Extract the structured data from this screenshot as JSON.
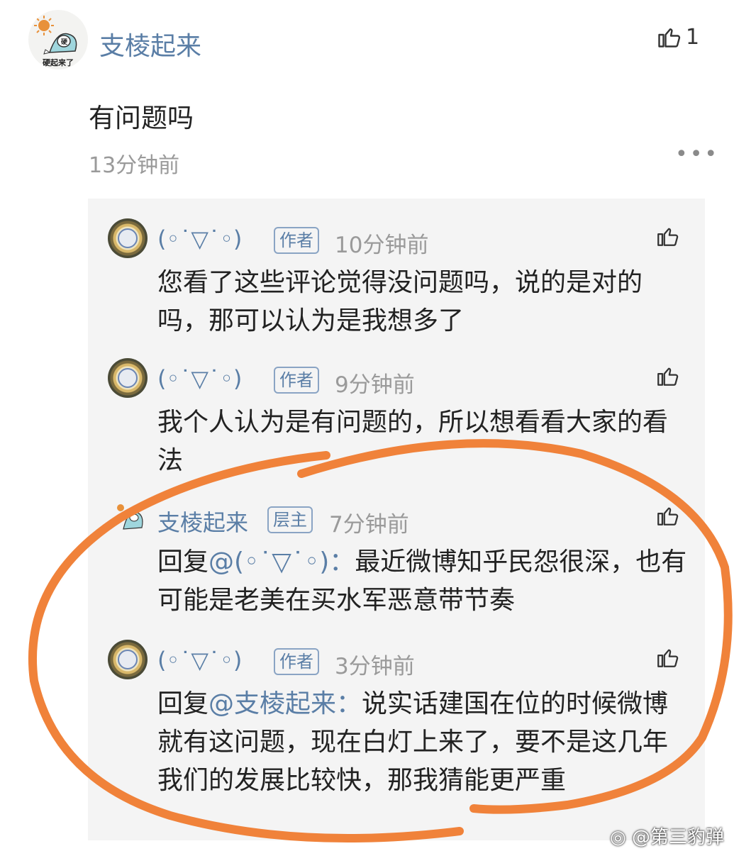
{
  "main_comment": {
    "avatar_caption": "硬起来了",
    "username": "支棱起来",
    "like_count": "1",
    "text": "有问题吗",
    "time": "13分钟前"
  },
  "replies": [
    {
      "name": "(◦˙▽˙◦)",
      "badge": "作者",
      "time": "10分钟前",
      "text": "您看了这些评论觉得没问题吗，说的是对的吗，那可以认为是我想多了"
    },
    {
      "name": "(◦˙▽˙◦)",
      "badge": "作者",
      "time": "9分钟前",
      "text": "我个人认为是有问题的，所以想看看大家的看法"
    },
    {
      "name": "支棱起来",
      "badge": "层主",
      "time": "7分钟前",
      "reply_prefix": "回复",
      "mention": "@(◦˙▽˙◦)：",
      "text": "最近微博知乎民怨很深，也有可能是老美在买水军恶意带节奏"
    },
    {
      "name": "(◦˙▽˙◦)",
      "badge": "作者",
      "time": "3分钟前",
      "reply_prefix": "回复",
      "mention": "@支棱起来：",
      "text": "说实话建国在位的时候微博就有这问题，现在白灯上来了，要不是这几年我们的发展比较快，那我猜能更严重"
    }
  ],
  "watermark": "@第三豹弹",
  "colors": {
    "username": "#5a7ea6",
    "annotation": "#f0823a",
    "panel": "#f4f4f4"
  },
  "icons": [
    "thumbs-up-icon",
    "more-icon",
    "weibo-logo-icon"
  ]
}
